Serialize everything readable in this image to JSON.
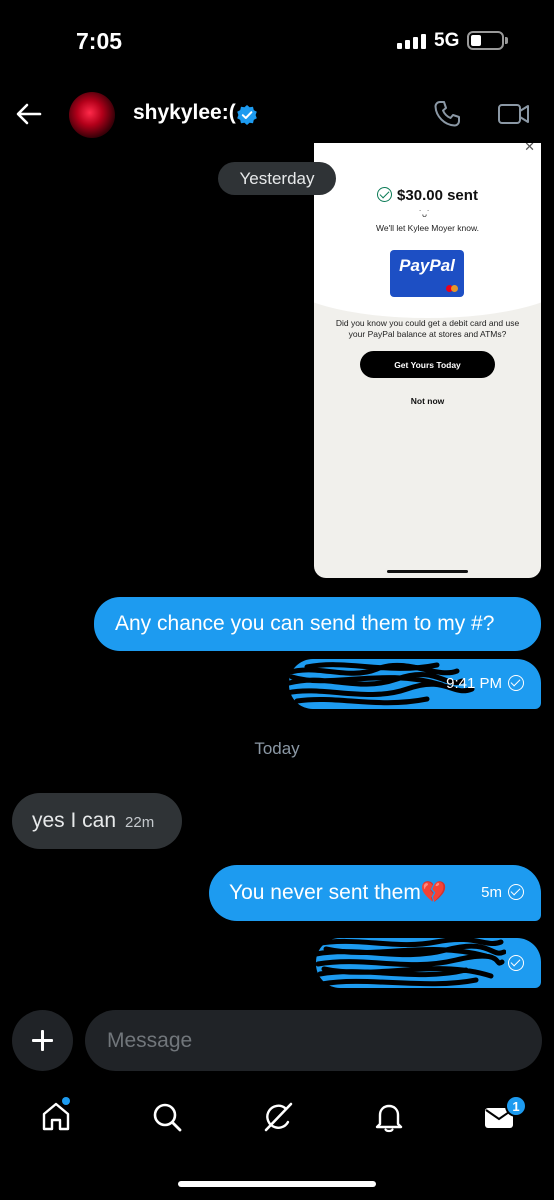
{
  "status_bar": {
    "time": "7:05",
    "network": "5G"
  },
  "header": {
    "username": "shykylee:("
  },
  "chat": {
    "day_yesterday": "Yesterday",
    "day_today": "Today",
    "embedded_screenshot": {
      "sent_text": "$30.00 sent",
      "notify_text": "We'll let Kylee Moyer know.",
      "card_brand": "PayPal",
      "promo_text": "Did you know you could get a debit card and use your PayPal balance at stores and ATMs?",
      "cta_button": "Get Yours Today",
      "secondary_button": "Not now"
    },
    "messages": [
      {
        "direction": "out",
        "text": "Any chance you can send them to my #?",
        "time": ""
      },
      {
        "direction": "out",
        "text": "",
        "time": "9:41 PM",
        "redacted": true
      },
      {
        "direction": "in",
        "text": "yes I can",
        "time": "22m"
      },
      {
        "direction": "out",
        "text": "You never sent them💔",
        "time": "5m"
      },
      {
        "direction": "out",
        "text": "",
        "time": "",
        "redacted": true
      }
    ]
  },
  "composer": {
    "placeholder": "Message"
  },
  "bottom_nav": {
    "items": [
      "home-icon",
      "search-icon",
      "grok-icon",
      "notifications-icon",
      "messages-icon"
    ],
    "messages_badge": "1"
  },
  "colors": {
    "accent": "#1d9bf0",
    "incoming_bubble": "#2f3336",
    "background": "#000000"
  }
}
